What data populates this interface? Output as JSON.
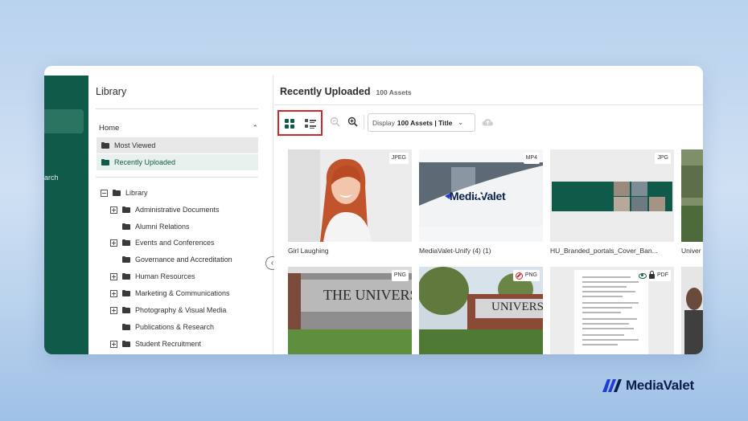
{
  "nav": {
    "search_label": "arch"
  },
  "library": {
    "title": "Library",
    "home_label": "Home",
    "quick_links": [
      {
        "label": "Most Viewed"
      },
      {
        "label": "Recently Uploaded"
      }
    ],
    "tree_root": "Library",
    "folders": [
      {
        "label": "Administrative Documents",
        "expandable": true
      },
      {
        "label": "Alumni Relations",
        "expandable": false
      },
      {
        "label": "Events and Conferences",
        "expandable": true
      },
      {
        "label": "Governance and Accreditation",
        "expandable": false
      },
      {
        "label": "Human Resources",
        "expandable": true
      },
      {
        "label": "Marketing & Communications",
        "expandable": true
      },
      {
        "label": "Photography & Visual Media",
        "expandable": true
      },
      {
        "label": "Publications & Research",
        "expandable": false
      },
      {
        "label": "Student Recruitment",
        "expandable": true
      }
    ]
  },
  "main": {
    "title": "Recently Uploaded",
    "count": "100 Assets",
    "display_prefix": "Display",
    "display_value": "100 Assets | Title"
  },
  "assets": [
    {
      "name": "Girl Laughing",
      "type": "JPEG"
    },
    {
      "name": "MediaValet-Unify (4) (1)",
      "type": "MP4",
      "overlay": "MediaValet"
    },
    {
      "name": "HU_Branded_portals_Cover_Ban...",
      "type": "JPG"
    },
    {
      "name": "Univer",
      "type": ""
    },
    {
      "name": "",
      "type": "PNG",
      "sign_text": "THE UNIVERSIT"
    },
    {
      "name": "",
      "type": "PNG",
      "sign_text": "UNIVERSI"
    },
    {
      "name": "",
      "type": "PDF"
    },
    {
      "name": "",
      "type": ""
    }
  ],
  "brand": {
    "name": "MediaValet"
  },
  "colors": {
    "accent": "#0f5a49",
    "highlight": "#d0262d",
    "brand_blue": "#1f3fd1",
    "brand_navy": "#0b1f4d"
  }
}
